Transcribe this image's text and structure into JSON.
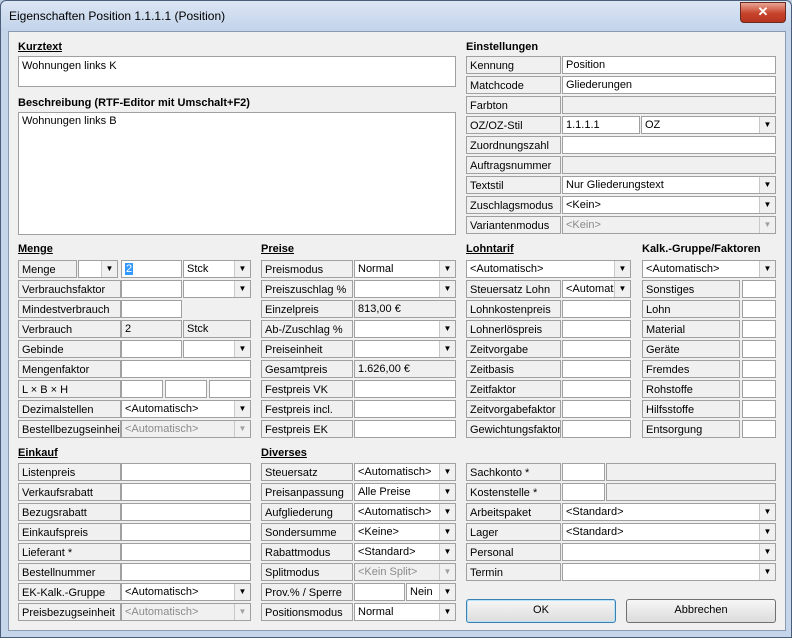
{
  "window": {
    "title": "Eigenschaften Position 1.1.1.1 (Position)",
    "close_glyph": "✕"
  },
  "kurztext": {
    "label": "Kurztext",
    "value": "Wohnungen links K"
  },
  "beschreibung": {
    "label": "Beschreibung (RTF-Editor mit Umschalt+F2)",
    "value": "Wohnungen links B"
  },
  "einstellungen": {
    "header": "Einstellungen",
    "kennung": {
      "label": "Kennung",
      "value": "Position"
    },
    "matchcode": {
      "label": "Matchcode",
      "value": "Gliederungen"
    },
    "farbton": {
      "label": "Farbton"
    },
    "ozstil": {
      "label": "OZ/OZ-Stil",
      "value": "1.1.1.1",
      "select": "OZ"
    },
    "zuordnungszahl": {
      "label": "Zuordnungszahl"
    },
    "auftragsnummer": {
      "label": "Auftragsnummer"
    },
    "textstil": {
      "label": "Textstil",
      "select": "Nur Gliederungstext"
    },
    "zuschlagsmodus": {
      "label": "Zuschlagsmodus",
      "select": "<Kein>"
    },
    "variantenmodus": {
      "label": "Variantenmodus",
      "select": "<Kein>"
    }
  },
  "menge": {
    "header": "Menge",
    "menge": {
      "label": "Menge",
      "value": "2",
      "unit": "Stck"
    },
    "verbrauchsfaktor": {
      "label": "Verbrauchsfaktor"
    },
    "mindestverbrauch": {
      "label": "Mindestverbrauch"
    },
    "verbrauch": {
      "label": "Verbrauch",
      "value": "2",
      "unit": "Stck"
    },
    "gebinde": {
      "label": "Gebinde"
    },
    "mengenfaktor": {
      "label": "Mengenfaktor"
    },
    "lbh": {
      "label": "L × B × H"
    },
    "dezimalstellen": {
      "label": "Dezimalstellen",
      "select": "<Automatisch>"
    },
    "bestellbezugseinheit": {
      "label": "Bestellbezugseinheit",
      "select": "<Automatisch>"
    }
  },
  "preise": {
    "header": "Preise",
    "preismodus": {
      "label": "Preismodus",
      "select": "Normal"
    },
    "preiszuschlag": {
      "label": "Preiszuschlag %"
    },
    "einzelpreis": {
      "label": "Einzelpreis",
      "value": "813,00 €"
    },
    "abzuschlag": {
      "label": "Ab-/Zuschlag %"
    },
    "preiseinheit": {
      "label": "Preiseinheit"
    },
    "gesamtpreis": {
      "label": "Gesamtpreis",
      "value": "1.626,00 €"
    },
    "festpreisvk": {
      "label": "Festpreis VK"
    },
    "festpreisinkl": {
      "label": "Festpreis incl."
    },
    "festpreisek": {
      "label": "Festpreis EK"
    }
  },
  "lohntarif": {
    "header": "Lohntarif",
    "select": "<Automatisch>",
    "steuersatz": {
      "label": "Steuersatz Lohn",
      "select": "<Automat"
    },
    "lohnkostenpreis": {
      "label": "Lohnkostenpreis"
    },
    "lohnerloespreis": {
      "label": "Lohnerlöspreis"
    },
    "zeitvorgabe": {
      "label": "Zeitvorgabe"
    },
    "zeitbasis": {
      "label": "Zeitbasis"
    },
    "zeitfaktor": {
      "label": "Zeitfaktor"
    },
    "zeitvorgabefaktor": {
      "label": "Zeitvorgabefaktor"
    },
    "gewichtungsfaktor": {
      "label": "Gewichtungsfaktor"
    }
  },
  "kalk": {
    "header": "Kalk.-Gruppe/Faktoren",
    "select": "<Automatisch>",
    "items": [
      "Sonstiges",
      "Lohn",
      "Material",
      "Geräte",
      "Fremdes",
      "Rohstoffe",
      "Hilfsstoffe",
      "Entsorgung"
    ]
  },
  "einkauf": {
    "header": "Einkauf",
    "listenpreis": {
      "label": "Listenpreis"
    },
    "verkaufsrabatt": {
      "label": "Verkaufsrabatt"
    },
    "bezugsrabatt": {
      "label": "Bezugsrabatt"
    },
    "einkaufspreis": {
      "label": "Einkaufspreis"
    },
    "lieferant": {
      "label": "Lieferant *"
    },
    "bestellnummer": {
      "label": "Bestellnummer"
    },
    "ekkalk": {
      "label": "EK-Kalk.-Gruppe",
      "select": "<Automatisch>"
    },
    "preisbezugseinheit": {
      "label": "Preisbezugseinheit",
      "select": "<Automatisch>"
    }
  },
  "diverses": {
    "header": "Diverses",
    "steuersatz": {
      "label": "Steuersatz",
      "select": "<Automatisch>"
    },
    "preisanpassung": {
      "label": "Preisanpassung",
      "select": "Alle Preise"
    },
    "aufgliederung": {
      "label": "Aufgliederung",
      "select": "<Automatisch>"
    },
    "sondersumme": {
      "label": "Sondersumme",
      "select": "<Keine>"
    },
    "rabattmodus": {
      "label": "Rabattmodus",
      "select": "<Standard>"
    },
    "splitmodus": {
      "label": "Splitmodus",
      "select": "<Kein Split>"
    },
    "prov": {
      "label": "Prov.% / Sperre",
      "select": "Nein"
    },
    "positionsmodus": {
      "label": "Positionsmodus",
      "select": "Normal"
    }
  },
  "rechts": {
    "sachkonto": {
      "label": "Sachkonto *"
    },
    "kostenstelle": {
      "label": "Kostenstelle *"
    },
    "arbeitspaket": {
      "label": "Arbeitspaket",
      "select": "<Standard>"
    },
    "lager": {
      "label": "Lager",
      "select": "<Standard>"
    },
    "personal": {
      "label": "Personal"
    },
    "termin": {
      "label": "Termin"
    }
  },
  "buttons": {
    "ok": "OK",
    "abbrechen": "Abbrechen"
  },
  "icons": {
    "dropdown_arrow": "▼"
  }
}
